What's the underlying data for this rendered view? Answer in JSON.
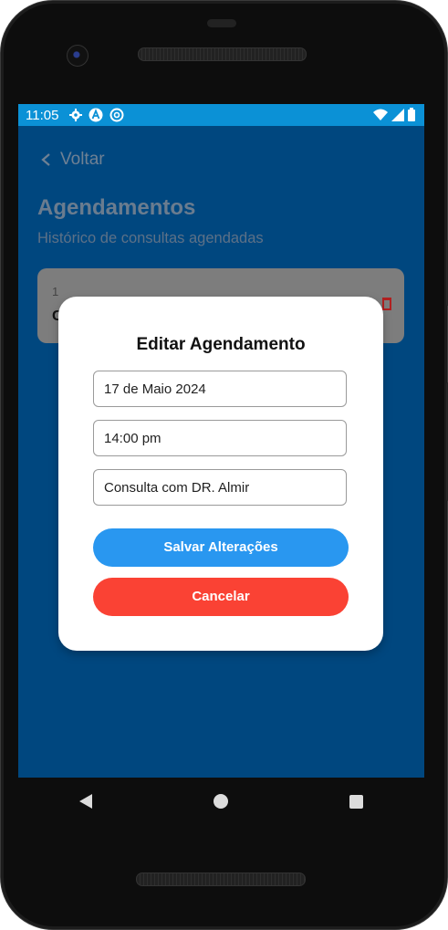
{
  "status_bar": {
    "time": "11:05",
    "icons_left": [
      "settings-icon",
      "a-badge-icon",
      "at-sync-icon"
    ],
    "icons_right": [
      "wifi-icon",
      "signal-icon",
      "battery-icon"
    ],
    "color": "#0b91d6"
  },
  "header": {
    "back_label": "Voltar",
    "title": "Agendamentos",
    "subtitle": "Histórico de consultas agendadas"
  },
  "appointment_card": {
    "line1": "1",
    "line2": "C"
  },
  "modal": {
    "title": "Editar Agendamento",
    "fields": {
      "date": "17 de Maio 2024",
      "time": "14:00 pm",
      "description": "Consulta com DR. Almir"
    },
    "save_label": "Salvar Alterações",
    "cancel_label": "Cancelar"
  },
  "colors": {
    "background": "#00477f",
    "save_button": "#2997f0",
    "cancel_button": "#fa4234"
  },
  "nav_bar": [
    "back-icon",
    "home-icon",
    "recents-icon"
  ]
}
